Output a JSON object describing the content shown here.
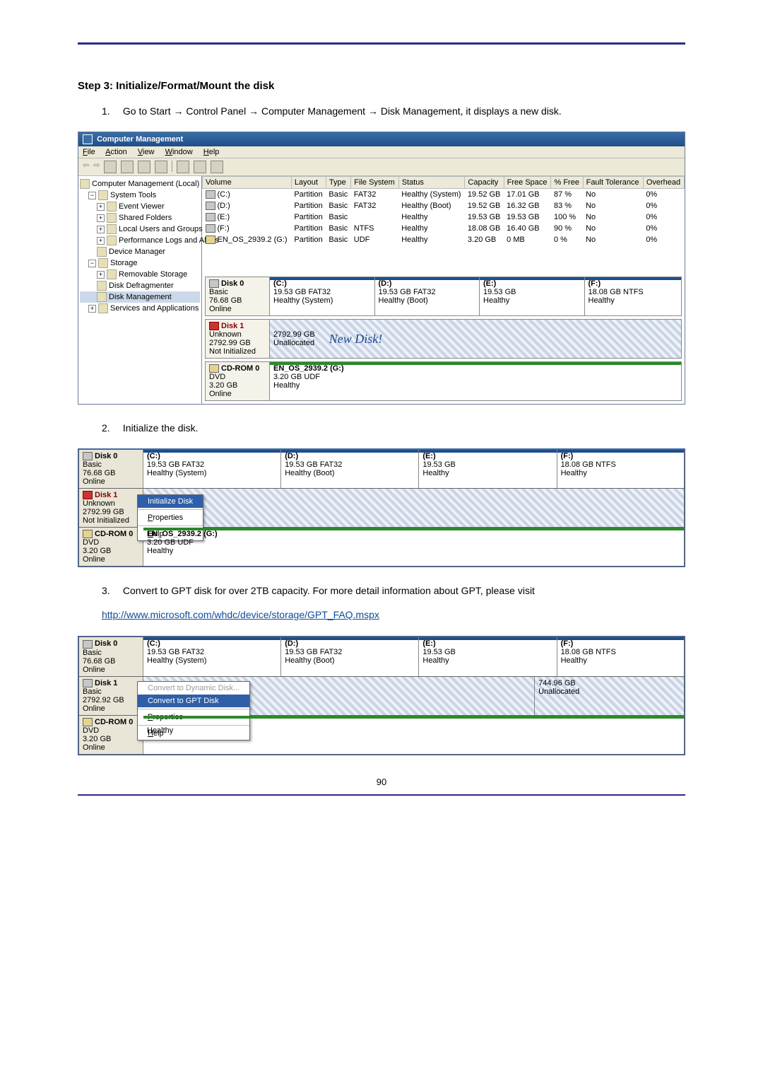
{
  "page_number": "90",
  "step_title": "Step 3: Initialize/Format/Mount the disk",
  "instr1_num": "1.",
  "instr1_text": "Go to Start → Control Panel → Computer Management → Disk Management, it displays a new disk.",
  "instr2_num": "2.",
  "instr2_text": "Initialize the disk.",
  "instr3_num": "3.",
  "instr3_text": "Convert to GPT disk for over 2TB capacity. For more detail information about GPT, please visit",
  "instr3_link": "http://www.microsoft.com/whdc/device/storage/GPT_FAQ.mspx",
  "cm": {
    "title": "Computer Management",
    "menu": {
      "file": "File",
      "action": "Action",
      "view": "View",
      "window": "Window",
      "help": "Help"
    },
    "tree": {
      "root": "Computer Management (Local)",
      "systools": "System Tools",
      "event": "Event Viewer",
      "shared": "Shared Folders",
      "local": "Local Users and Groups",
      "perf": "Performance Logs and Alerts",
      "devmgr": "Device Manager",
      "storage": "Storage",
      "removable": "Removable Storage",
      "defrag": "Disk Defragmenter",
      "diskmgmt": "Disk Management",
      "services": "Services and Applications"
    },
    "cols": {
      "volume": "Volume",
      "layout": "Layout",
      "type": "Type",
      "fs": "File System",
      "status": "Status",
      "capacity": "Capacity",
      "free": "Free Space",
      "pct": "% Free",
      "fault": "Fault Tolerance",
      "overhead": "Overhead"
    },
    "vols": [
      {
        "v": "(C:)",
        "l": "Partition",
        "t": "Basic",
        "fs": "FAT32",
        "s": "Healthy (System)",
        "c": "19.52 GB",
        "fr": "17.01 GB",
        "p": "87 %",
        "ft": "No",
        "o": "0%"
      },
      {
        "v": "(D:)",
        "l": "Partition",
        "t": "Basic",
        "fs": "FAT32",
        "s": "Healthy (Boot)",
        "c": "19.52 GB",
        "fr": "16.32 GB",
        "p": "83 %",
        "ft": "No",
        "o": "0%"
      },
      {
        "v": "(E:)",
        "l": "Partition",
        "t": "Basic",
        "fs": "",
        "s": "Healthy",
        "c": "19.53 GB",
        "fr": "19.53 GB",
        "p": "100 %",
        "ft": "No",
        "o": "0%"
      },
      {
        "v": "(F:)",
        "l": "Partition",
        "t": "Basic",
        "fs": "NTFS",
        "s": "Healthy",
        "c": "18.08 GB",
        "fr": "16.40 GB",
        "p": "90 %",
        "ft": "No",
        "o": "0%"
      },
      {
        "v": "EN_OS_2939.2 (G:)",
        "l": "Partition",
        "t": "Basic",
        "fs": "UDF",
        "s": "Healthy",
        "c": "3.20 GB",
        "fr": "0 MB",
        "p": "0 %",
        "ft": "No",
        "o": "0%"
      }
    ],
    "disk0": {
      "name": "Disk 0",
      "type": "Basic",
      "size": "76.68 GB",
      "status": "Online",
      "c": {
        "t": "(C:)",
        "s": "19.53 GB FAT32",
        "st": "Healthy (System)"
      },
      "d": {
        "t": "(D:)",
        "s": "19.53 GB FAT32",
        "st": "Healthy (Boot)"
      },
      "e": {
        "t": "(E:)",
        "s": "19.53 GB",
        "st": "Healthy"
      },
      "f": {
        "t": "(F:)",
        "s": "18.08 GB NTFS",
        "st": "Healthy"
      }
    },
    "disk1": {
      "name": "Disk 1",
      "type": "Unknown",
      "size": "2792.99 GB",
      "status": "Not Initialized",
      "part_size": "2792.99 GB",
      "part_status": "Unallocated",
      "annot": "New Disk!"
    },
    "cd": {
      "name": "CD-ROM 0",
      "type": "DVD",
      "size": "3.20 GB",
      "status": "Online",
      "vol": "EN_OS_2939.2 (G:)",
      "vs": "3.20 GB UDF",
      "vst": "Healthy"
    }
  },
  "shot2": {
    "ctx": {
      "init": "Initialize Disk",
      "props": "Properties",
      "help": "Help"
    }
  },
  "shot3": {
    "disk1": {
      "name": "Disk 1",
      "type": "Basic",
      "size": "2792.92 GB",
      "status": "Online",
      "unalloc_size": "744.96 GB",
      "unalloc_label": "Unallocated"
    },
    "ctx": {
      "dyn": "Convert to Dynamic Disk...",
      "gpt": "Convert to GPT Disk",
      "props": "Properties",
      "help": "Help"
    },
    "cd_vst": "Healthy"
  }
}
